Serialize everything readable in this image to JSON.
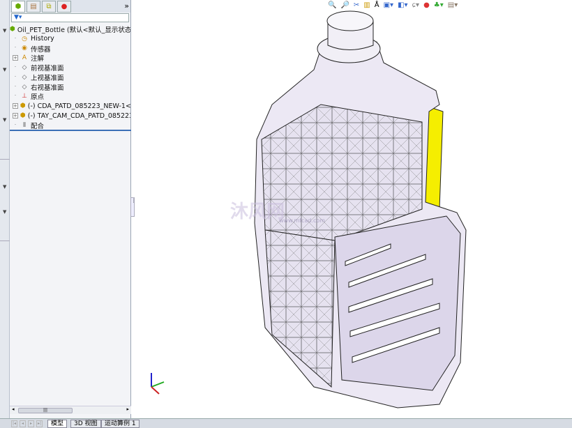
{
  "tree": {
    "root": "Oil_PET_Bottle  (默认<默认_显示状态",
    "items": [
      {
        "label": "History",
        "icon": "history-icon",
        "expand": false
      },
      {
        "label": "传感器",
        "icon": "sensor-icon",
        "expand": false
      },
      {
        "label": "注解",
        "icon": "annotation-icon",
        "expand": true
      },
      {
        "label": "前视基准面",
        "icon": "plane-icon",
        "expand": false
      },
      {
        "label": "上视基准面",
        "icon": "plane-icon",
        "expand": false
      },
      {
        "label": "右视基准面",
        "icon": "plane-icon",
        "expand": false
      },
      {
        "label": "原点",
        "icon": "origin-icon",
        "expand": false
      },
      {
        "label": "(-) CDA_PATD_085223_NEW-1<",
        "icon": "part-icon",
        "expand": true
      },
      {
        "label": "(-) TAY_CAM_CDA_PATD_085223",
        "icon": "part-icon",
        "expand": true
      },
      {
        "label": "配合",
        "icon": "mates-icon",
        "expand": false
      }
    ]
  },
  "bottom_tabs": [
    "模型",
    "3D 视图",
    "运动算例 1"
  ],
  "watermark": {
    "text": "沐风网",
    "url": "www.mfcad.com"
  },
  "colors": {
    "panel_bg": "#f3f4f7",
    "accent": "#3b6fb6",
    "handle": "#f5ee00",
    "body": "#e8e4f2"
  }
}
